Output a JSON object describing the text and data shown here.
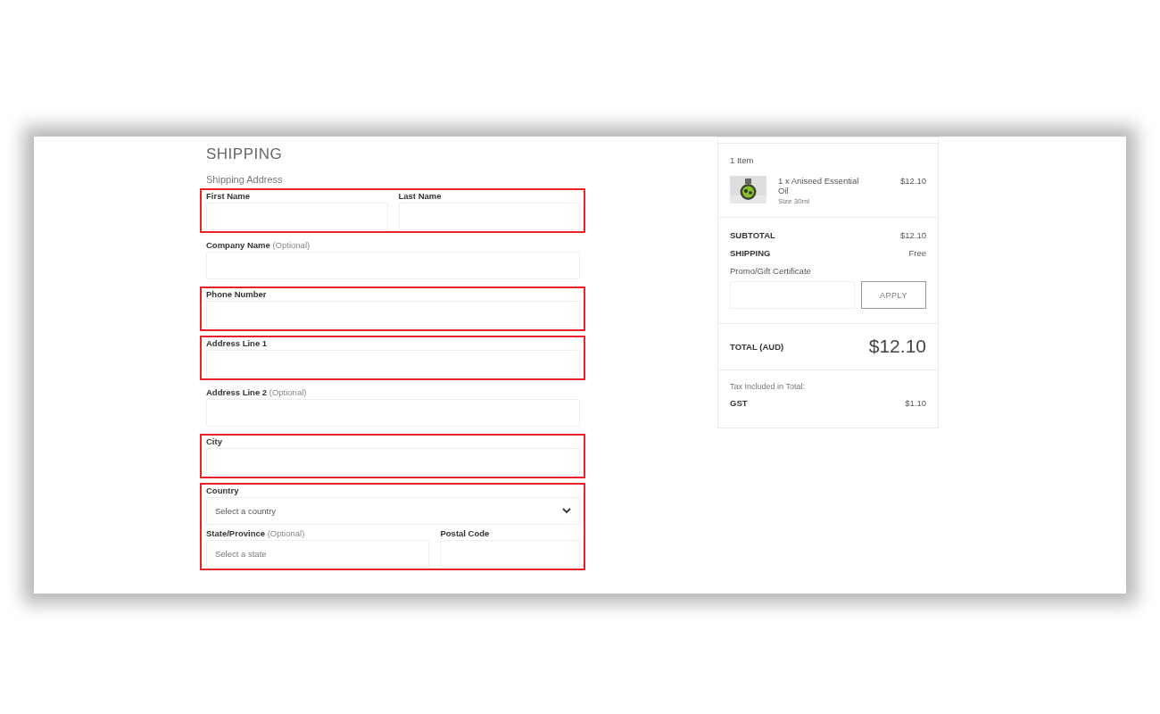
{
  "checkout": {
    "title": "SHIPPING",
    "subtitle": "Shipping Address",
    "groups": [
      {
        "highlighted": true,
        "rows": [
          [
            {
              "label": "First Name",
              "kind": "text"
            },
            {
              "label": "Last Name",
              "kind": "text"
            }
          ]
        ]
      },
      {
        "highlighted": false,
        "rows": [
          [
            {
              "label": "Company Name",
              "note": "(Optional)",
              "kind": "text"
            }
          ]
        ]
      },
      {
        "highlighted": true,
        "rows": [
          [
            {
              "label": "Phone Number",
              "kind": "text"
            }
          ]
        ]
      },
      {
        "highlighted": true,
        "rows": [
          [
            {
              "label": "Address Line 1",
              "kind": "text"
            }
          ]
        ]
      },
      {
        "highlighted": false,
        "rows": [
          [
            {
              "label": "Address Line 2",
              "note": "(Optional)",
              "kind": "text"
            }
          ]
        ]
      },
      {
        "highlighted": true,
        "rows": [
          [
            {
              "label": "City",
              "kind": "text"
            }
          ]
        ]
      },
      {
        "highlighted": true,
        "rows": [
          [
            {
              "label": "Country",
              "kind": "dropdown",
              "placeholder": "Select a country"
            }
          ],
          [
            {
              "label": "State/Province",
              "note": "(Optional)",
              "kind": "lookup",
              "placeholder": "Select a state"
            },
            {
              "label": "Postal Code",
              "kind": "text"
            }
          ]
        ]
      }
    ]
  },
  "summary": {
    "item_count": "1 Item",
    "items": [
      {
        "name": "1 x Aniseed Essential Oil",
        "detail": "Size 30ml",
        "price": "$12.10"
      }
    ],
    "lines": [
      {
        "label": "SUBTOTAL",
        "value": "$12.10"
      },
      {
        "label": "SHIPPING",
        "value": "Free"
      }
    ],
    "promo": {
      "label": "Promo/Gift Certificate",
      "button": "APPLY"
    },
    "total": {
      "label": "TOTAL (AUD)",
      "value": "$12.10"
    },
    "tax": {
      "heading": "Tax Included in Total:",
      "lines": [
        {
          "label": "GST",
          "value": "$1.10"
        }
      ]
    }
  }
}
